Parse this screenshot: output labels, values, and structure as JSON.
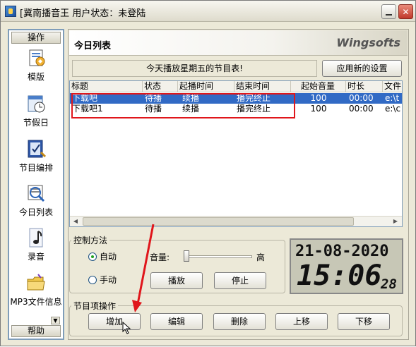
{
  "window": {
    "title": "[冀南播音王  用户状态：未登陆",
    "minimize_icon": "minimize-icon",
    "close_icon": "close-icon",
    "close_label": "✕"
  },
  "sidebar": {
    "header": "操作",
    "footer": "帮助",
    "items": [
      {
        "label": "模版",
        "icon": "template-icon"
      },
      {
        "label": "节假日",
        "icon": "holiday-clock-icon"
      },
      {
        "label": "节目编排",
        "icon": "program-edit-icon"
      },
      {
        "label": "今日列表",
        "icon": "today-list-icon"
      },
      {
        "label": "录音",
        "icon": "music-note-icon"
      },
      {
        "label": "MP3文件信息",
        "icon": "folder-icon"
      }
    ]
  },
  "main": {
    "title": "今日列表",
    "brand": "Wingsofts",
    "notice": "今天播放星期五的节目表!",
    "apply_button": "应用新的设置"
  },
  "table": {
    "columns": [
      "标题",
      "状态",
      "起播时间",
      "结束时间",
      "起始音量",
      "时长",
      "文件"
    ],
    "rows": [
      {
        "title": "下载吧",
        "status": "待播",
        "start": "续播",
        "end": "播完终止",
        "volume": "100",
        "duration": "00:00",
        "file": "e:\\t"
      },
      {
        "title": "下载吧1",
        "status": "待播",
        "start": "续播",
        "end": "播完终止",
        "volume": "100",
        "duration": "00:00",
        "file": "e:\\c"
      }
    ],
    "selected_row": 0
  },
  "control": {
    "legend": "控制方法",
    "auto_label": "自动",
    "manual_label": "手动",
    "mode": "auto",
    "volume_label": "音量:",
    "volume_high_label": "高",
    "volume_level": 0.0,
    "play_button": "播放",
    "stop_button": "停止"
  },
  "clock": {
    "date": "21-08-2020",
    "time": "15:06",
    "seconds": "28"
  },
  "program_ops": {
    "legend": "节目项操作",
    "add": "增加",
    "edit": "编辑",
    "delete": "删除",
    "up": "上移",
    "down": "下移"
  },
  "colors": {
    "selection": "#316ac5",
    "annotation_red": "#e0161b",
    "window_bg": "#ece9d8"
  }
}
